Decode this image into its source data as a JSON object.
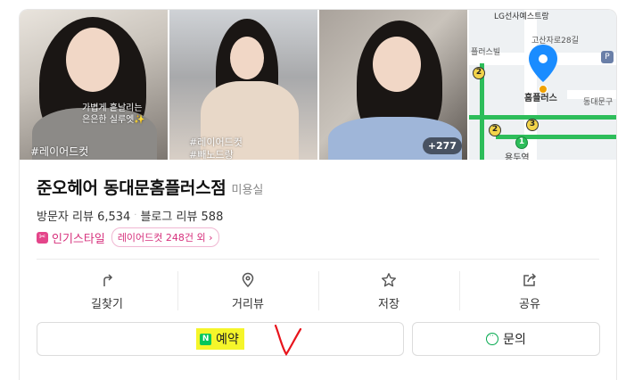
{
  "place": {
    "name": "준오헤어 동대문홈플러스점",
    "category": "미용실",
    "visitor_reviews_label": "방문자 리뷰 6,534",
    "blog_reviews_label": "블로그 리뷰 588",
    "popular_label": "인기스타일",
    "popular_pill": "레이어드컷 248건 외"
  },
  "photos": {
    "p1_caption": "가볍게 흩날리는\n은은한 실루엣✨",
    "p1_tag": "#레이어드컷",
    "p2_caption_1": "#레이어드컷",
    "p2_caption_2": "#빼노드랑",
    "more_count": "+277"
  },
  "map": {
    "label_top": "LG선사예스트랑",
    "label_road": "고산자로28길",
    "label_left": "플러스빌",
    "label_pin": "홈플러스",
    "label_right": "동대문구",
    "label_bottom": "용두역",
    "stop_2a": "2",
    "stop_2b": "2",
    "stop_3": "3",
    "stop_1": "1"
  },
  "actions": [
    {
      "label": "길찾기",
      "icon": "directions-icon"
    },
    {
      "label": "거리뷰",
      "icon": "location-pin-icon"
    },
    {
      "label": "저장",
      "icon": "star-icon"
    },
    {
      "label": "공유",
      "icon": "share-icon"
    }
  ],
  "buttons": {
    "reserve_icon": "N",
    "reserve_label": "예약",
    "inquiry_label": "문의"
  },
  "colors": {
    "naver_green": "#03c75a",
    "highlight": "#f5f52a",
    "pink": "#d6307c",
    "pin_blue": "#1a8cff"
  }
}
